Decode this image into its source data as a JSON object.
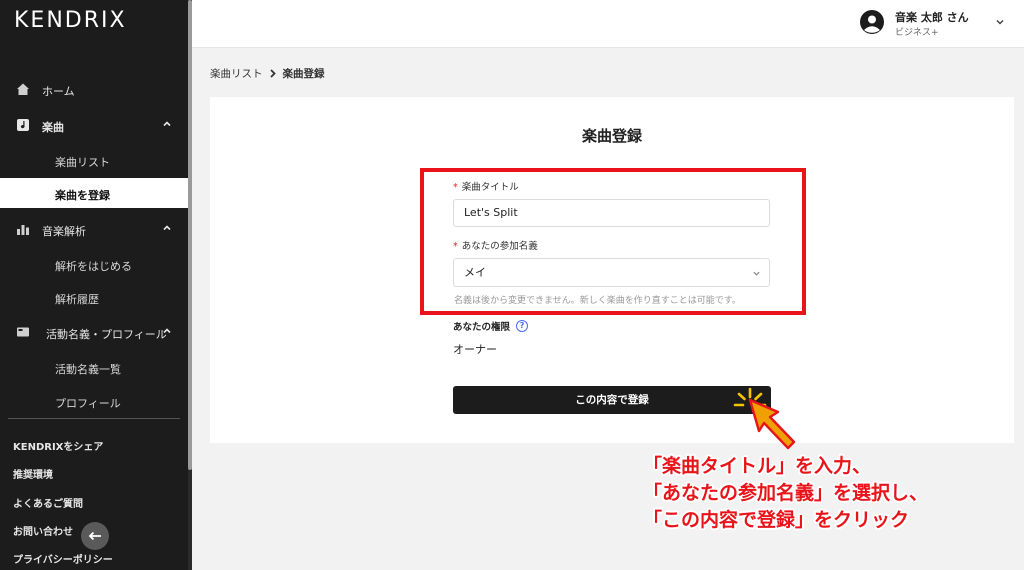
{
  "app": {
    "logo_text": "KENDRIX"
  },
  "sidebar": {
    "items": [
      {
        "label": "ホーム",
        "icon": "home-icon"
      },
      {
        "label": "楽曲",
        "icon": "music-note-icon"
      },
      {
        "label": "楽曲リスト"
      },
      {
        "label": "楽曲を登録",
        "active": true
      },
      {
        "label": "音楽解析",
        "icon": "bar-chart-icon"
      },
      {
        "label": "解析をはじめる"
      },
      {
        "label": "解析履歴"
      },
      {
        "label": "活動名義・プロフィール",
        "icon": "profile-card-icon"
      },
      {
        "label": "活動名義一覧"
      },
      {
        "label": "プロフィール"
      }
    ],
    "footer_links": [
      "KENDRIXをシェア",
      "推奨環境",
      "よくあるご質問",
      "お問い合わせ",
      "プライバシーポリシー"
    ]
  },
  "header": {
    "user_name": "音楽 太郎 さん",
    "user_plan": "ビジネス+"
  },
  "breadcrumb": {
    "parent": "楽曲リスト",
    "current": "楽曲登録"
  },
  "form": {
    "title": "楽曲登録",
    "title_field_label": "楽曲タイトル",
    "title_field_value": "Let's Split",
    "name_field_label": "あなたの参加名義",
    "name_field_value": "メイ",
    "help_text": "名義は後から変更できません。新しく楽曲を作り直すことは可能です。",
    "permission_label": "あなたの権限",
    "permission_value": "オーナー",
    "submit_label": "この内容で登録"
  },
  "annotation": {
    "lines": [
      "「楽曲タイトル」を入力、",
      "「あなたの参加名義」を選択し、",
      "「この内容で登録」をクリック"
    ],
    "color": "#e8141a"
  }
}
